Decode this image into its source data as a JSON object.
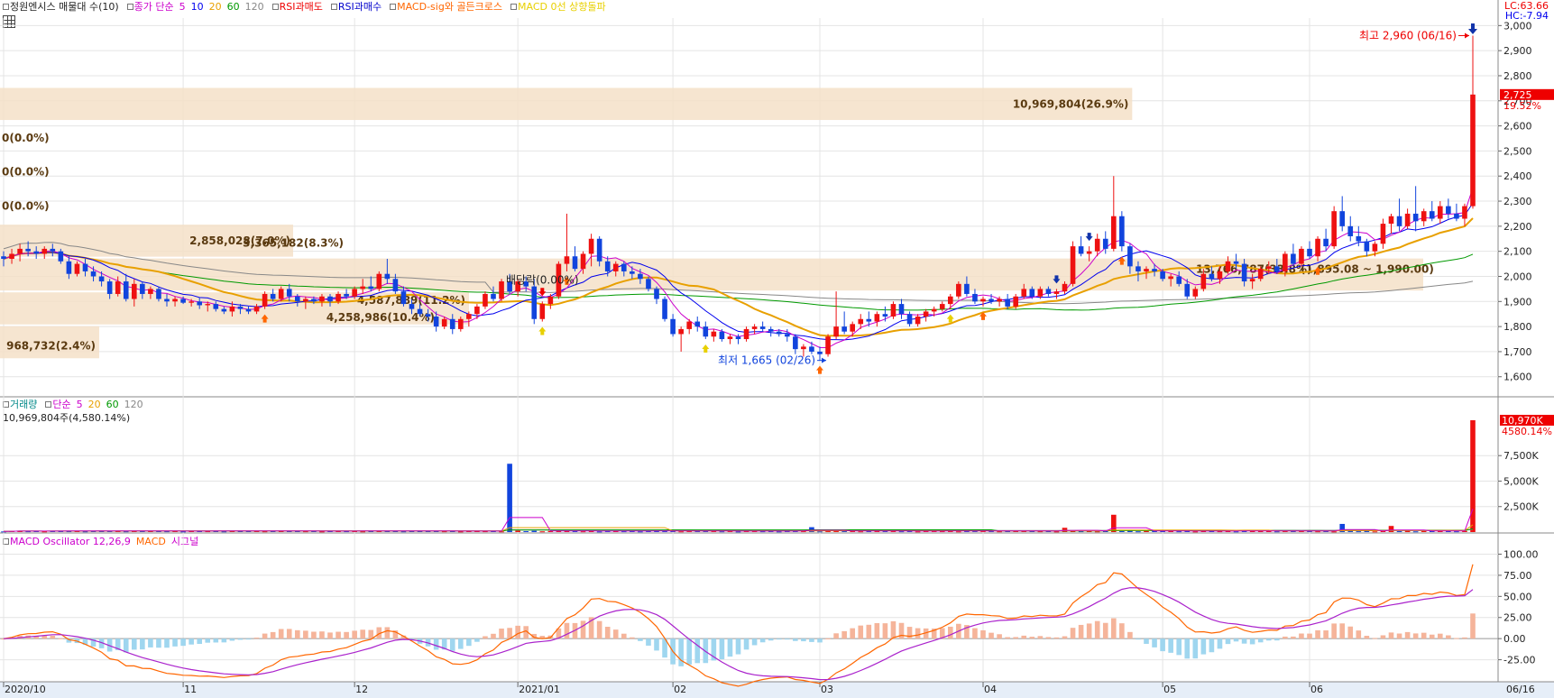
{
  "legend_price": [
    {
      "text": "정원엔시스 매물대 수(10)",
      "color": "#222222"
    },
    {
      "text": "종가 단순",
      "color": "#cc00cc"
    },
    {
      "text": "5",
      "color": "#cc00cc"
    },
    {
      "text": "10",
      "color": "#0000ee"
    },
    {
      "text": "20",
      "color": "#e8a000"
    },
    {
      "text": "60",
      "color": "#009900"
    },
    {
      "text": "120",
      "color": "#888888"
    },
    {
      "text": "RSI과매도",
      "color": "#ee0000"
    },
    {
      "text": "RSI과매수",
      "color": "#0000cc"
    },
    {
      "text": "MACD-sig와 골든크로스",
      "color": "#ff6600"
    },
    {
      "text": "MACD 0선 상향돌파",
      "color": "#e8d000"
    }
  ],
  "legend_volume": [
    {
      "text": "거래량",
      "color": "#008888"
    },
    {
      "text": "단순",
      "color": "#cc00cc"
    },
    {
      "text": "5",
      "color": "#cc00cc"
    },
    {
      "text": "20",
      "color": "#e8a000"
    },
    {
      "text": "60",
      "color": "#009900"
    },
    {
      "text": "120",
      "color": "#888888"
    }
  ],
  "legend_macd": [
    {
      "text": "MACD Oscillator 12,26,9",
      "color": "#cc00cc"
    },
    {
      "text": "MACD",
      "color": "#ff6600"
    },
    {
      "text": "시그널",
      "color": "#cc00cc"
    }
  ],
  "corner": {
    "lc": "LC:63.66",
    "hc": "HC:-7.94"
  },
  "volume_info": "10,969,804주(4,580.14%)",
  "chart_data": {
    "type": "candlestick",
    "title": "정원엔시스",
    "price_axis": {
      "ticks": [
        1600,
        1700,
        1800,
        1900,
        2000,
        2100,
        2200,
        2300,
        2400,
        2500,
        2600,
        2700,
        2800,
        2900,
        3000
      ],
      "ylim": [
        1520,
        3030
      ]
    },
    "x_labels": [
      "2020/10",
      "11",
      "12",
      "2021/01",
      "02",
      "03",
      "04",
      "05",
      "06",
      "06/16"
    ],
    "month_starts": [
      0,
      22,
      43,
      63,
      82,
      100,
      120,
      142,
      160
    ],
    "last_price": {
      "value": 2725,
      "label": "2,725",
      "change": "19.52%",
      "color": "#ee0000"
    },
    "high_annotation": {
      "label": "최고 2,960 (06/16)",
      "value": 2960
    },
    "low_annotation": {
      "label": "최저 1,665 (02/26)",
      "value": 1665
    },
    "dividend_annotation": "배당락(0.00%)",
    "ohlc": [
      [
        2080,
        2100,
        2040,
        2070
      ],
      [
        2070,
        2110,
        2050,
        2090
      ],
      [
        2090,
        2130,
        2060,
        2110
      ],
      [
        2110,
        2140,
        2080,
        2100
      ],
      [
        2100,
        2120,
        2070,
        2090
      ],
      [
        2090,
        2120,
        2070,
        2110
      ],
      [
        2110,
        2130,
        2080,
        2100
      ],
      [
        2100,
        2110,
        2050,
        2060
      ],
      [
        2060,
        2080,
        1990,
        2010
      ],
      [
        2010,
        2060,
        2000,
        2050
      ],
      [
        2050,
        2070,
        2000,
        2020
      ],
      [
        2020,
        2040,
        1980,
        2000
      ],
      [
        2000,
        2020,
        1960,
        1980
      ],
      [
        1980,
        1990,
        1910,
        1930
      ],
      [
        1930,
        2000,
        1920,
        1980
      ],
      [
        1980,
        2010,
        1900,
        1910
      ],
      [
        1910,
        1990,
        1880,
        1970
      ],
      [
        1970,
        1980,
        1910,
        1930
      ],
      [
        1930,
        1960,
        1910,
        1950
      ],
      [
        1950,
        1960,
        1900,
        1910
      ],
      [
        1910,
        1930,
        1880,
        1900
      ],
      [
        1900,
        1920,
        1880,
        1910
      ],
      [
        1910,
        1920,
        1890,
        1895
      ],
      [
        1895,
        1910,
        1880,
        1900
      ],
      [
        1900,
        1915,
        1870,
        1885
      ],
      [
        1885,
        1900,
        1860,
        1890
      ],
      [
        1890,
        1900,
        1860,
        1870
      ],
      [
        1870,
        1880,
        1850,
        1860
      ],
      [
        1860,
        1900,
        1840,
        1880
      ],
      [
        1880,
        1890,
        1850,
        1870
      ],
      [
        1870,
        1880,
        1850,
        1860
      ],
      [
        1860,
        1890,
        1850,
        1880
      ],
      [
        1880,
        1940,
        1870,
        1930
      ],
      [
        1930,
        1950,
        1900,
        1910
      ],
      [
        1910,
        1960,
        1900,
        1950
      ],
      [
        1950,
        1970,
        1900,
        1920
      ],
      [
        1920,
        1930,
        1880,
        1900
      ],
      [
        1900,
        1920,
        1870,
        1910
      ],
      [
        1910,
        1920,
        1890,
        1900
      ],
      [
        1900,
        1930,
        1880,
        1920
      ],
      [
        1920,
        1930,
        1880,
        1900
      ],
      [
        1900,
        1940,
        1890,
        1930
      ],
      [
        1930,
        1950,
        1910,
        1920
      ],
      [
        1920,
        1960,
        1910,
        1950
      ],
      [
        1950,
        1990,
        1930,
        1960
      ],
      [
        1960,
        2000,
        1940,
        1950
      ],
      [
        1950,
        2020,
        1940,
        2010
      ],
      [
        2010,
        2070,
        1970,
        1990
      ],
      [
        1990,
        2010,
        1930,
        1940
      ],
      [
        1940,
        1960,
        1880,
        1890
      ],
      [
        1890,
        1910,
        1850,
        1870
      ],
      [
        1870,
        1890,
        1840,
        1850
      ],
      [
        1850,
        1870,
        1820,
        1840
      ],
      [
        1840,
        1860,
        1780,
        1800
      ],
      [
        1800,
        1840,
        1790,
        1830
      ],
      [
        1830,
        1850,
        1770,
        1790
      ],
      [
        1790,
        1840,
        1780,
        1830
      ],
      [
        1830,
        1860,
        1800,
        1850
      ],
      [
        1850,
        1890,
        1830,
        1880
      ],
      [
        1880,
        1940,
        1870,
        1930
      ],
      [
        1930,
        1960,
        1900,
        1910
      ],
      [
        1910,
        1990,
        1900,
        1980
      ],
      [
        1980,
        2010,
        1930,
        1940
      ],
      [
        1940,
        1990,
        1920,
        1980
      ],
      [
        1980,
        2000,
        1940,
        1960
      ],
      [
        1960,
        1990,
        1810,
        1830
      ],
      [
        1830,
        1900,
        1820,
        1890
      ],
      [
        1890,
        1930,
        1870,
        1920
      ],
      [
        1920,
        2060,
        1910,
        2050
      ],
      [
        2050,
        2250,
        2020,
        2080
      ],
      [
        2080,
        2120,
        2020,
        2030
      ],
      [
        2030,
        2100,
        2010,
        2090
      ],
      [
        2090,
        2170,
        2040,
        2150
      ],
      [
        2150,
        2160,
        2040,
        2060
      ],
      [
        2060,
        2080,
        2000,
        2020
      ],
      [
        2020,
        2060,
        2000,
        2050
      ],
      [
        2050,
        2060,
        2000,
        2020
      ],
      [
        2020,
        2040,
        1990,
        2010
      ],
      [
        2010,
        2030,
        1970,
        1990
      ],
      [
        1990,
        2000,
        1940,
        1950
      ],
      [
        1950,
        1960,
        1890,
        1910
      ],
      [
        1910,
        1920,
        1820,
        1830
      ],
      [
        1830,
        1850,
        1760,
        1770
      ],
      [
        1770,
        1800,
        1700,
        1790
      ],
      [
        1790,
        1830,
        1770,
        1820
      ],
      [
        1820,
        1840,
        1780,
        1800
      ],
      [
        1800,
        1820,
        1750,
        1760
      ],
      [
        1760,
        1790,
        1740,
        1780
      ],
      [
        1780,
        1790,
        1740,
        1750
      ],
      [
        1750,
        1770,
        1730,
        1760
      ],
      [
        1760,
        1770,
        1730,
        1750
      ],
      [
        1750,
        1800,
        1740,
        1790
      ],
      [
        1790,
        1810,
        1770,
        1800
      ],
      [
        1800,
        1820,
        1780,
        1790
      ],
      [
        1790,
        1800,
        1760,
        1780
      ],
      [
        1780,
        1790,
        1760,
        1770
      ],
      [
        1770,
        1790,
        1740,
        1760
      ],
      [
        1760,
        1770,
        1690,
        1710
      ],
      [
        1710,
        1730,
        1680,
        1720
      ],
      [
        1720,
        1740,
        1690,
        1700
      ],
      [
        1700,
        1720,
        1665,
        1690
      ],
      [
        1690,
        1770,
        1680,
        1760
      ],
      [
        1760,
        1940,
        1750,
        1800
      ],
      [
        1800,
        1860,
        1770,
        1780
      ],
      [
        1780,
        1820,
        1760,
        1810
      ],
      [
        1810,
        1850,
        1790,
        1830
      ],
      [
        1830,
        1860,
        1800,
        1820
      ],
      [
        1820,
        1860,
        1800,
        1850
      ],
      [
        1850,
        1880,
        1820,
        1840
      ],
      [
        1840,
        1900,
        1830,
        1890
      ],
      [
        1890,
        1910,
        1830,
        1850
      ],
      [
        1850,
        1860,
        1800,
        1810
      ],
      [
        1810,
        1850,
        1800,
        1840
      ],
      [
        1840,
        1870,
        1820,
        1860
      ],
      [
        1860,
        1880,
        1840,
        1870
      ],
      [
        1870,
        1900,
        1860,
        1890
      ],
      [
        1890,
        1930,
        1870,
        1920
      ],
      [
        1920,
        1980,
        1910,
        1970
      ],
      [
        1970,
        2000,
        1920,
        1930
      ],
      [
        1930,
        1950,
        1890,
        1900
      ],
      [
        1900,
        1920,
        1880,
        1910
      ],
      [
        1910,
        1930,
        1890,
        1900
      ],
      [
        1900,
        1920,
        1880,
        1910
      ],
      [
        1910,
        1930,
        1870,
        1880
      ],
      [
        1880,
        1930,
        1870,
        1920
      ],
      [
        1920,
        1970,
        1910,
        1950
      ],
      [
        1950,
        1960,
        1910,
        1920
      ],
      [
        1920,
        1960,
        1910,
        1950
      ],
      [
        1950,
        1960,
        1920,
        1930
      ],
      [
        1930,
        1950,
        1910,
        1940
      ],
      [
        1940,
        1980,
        1930,
        1970
      ],
      [
        1970,
        2140,
        1960,
        2120
      ],
      [
        2120,
        2160,
        2080,
        2090
      ],
      [
        2090,
        2120,
        2060,
        2100
      ],
      [
        2100,
        2170,
        2080,
        2150
      ],
      [
        2150,
        2180,
        2090,
        2110
      ],
      [
        2110,
        2400,
        2100,
        2240
      ],
      [
        2240,
        2260,
        2100,
        2120
      ],
      [
        2120,
        2130,
        2010,
        2040
      ],
      [
        2040,
        2060,
        1980,
        2020
      ],
      [
        2020,
        2040,
        1990,
        2030
      ],
      [
        2030,
        2050,
        2000,
        2020
      ],
      [
        2020,
        2030,
        1980,
        1990
      ],
      [
        1990,
        2010,
        1960,
        2000
      ],
      [
        2000,
        2020,
        1960,
        1970
      ],
      [
        1970,
        1990,
        1910,
        1920
      ],
      [
        1920,
        1960,
        1910,
        1950
      ],
      [
        1950,
        2030,
        1940,
        2010
      ],
      [
        2010,
        2040,
        1980,
        1990
      ],
      [
        1990,
        2040,
        1970,
        2020
      ],
      [
        2020,
        2080,
        2010,
        2060
      ],
      [
        2060,
        2090,
        2030,
        2050
      ],
      [
        2050,
        2070,
        1960,
        1980
      ],
      [
        1980,
        2010,
        1950,
        1990
      ],
      [
        1990,
        2040,
        1980,
        2030
      ],
      [
        2030,
        2060,
        2010,
        2040
      ],
      [
        2040,
        2070,
        2010,
        2020
      ],
      [
        2020,
        2100,
        2000,
        2090
      ],
      [
        2090,
        2130,
        2040,
        2050
      ],
      [
        2050,
        2120,
        2040,
        2110
      ],
      [
        2110,
        2140,
        2070,
        2080
      ],
      [
        2080,
        2160,
        2060,
        2150
      ],
      [
        2150,
        2190,
        2100,
        2120
      ],
      [
        2120,
        2280,
        2110,
        2260
      ],
      [
        2260,
        2320,
        2180,
        2200
      ],
      [
        2200,
        2240,
        2140,
        2160
      ],
      [
        2160,
        2200,
        2120,
        2140
      ],
      [
        2140,
        2150,
        2080,
        2100
      ],
      [
        2100,
        2140,
        2080,
        2130
      ],
      [
        2130,
        2230,
        2110,
        2210
      ],
      [
        2210,
        2250,
        2170,
        2240
      ],
      [
        2240,
        2310,
        2180,
        2200
      ],
      [
        2200,
        2270,
        2190,
        2250
      ],
      [
        2250,
        2360,
        2180,
        2220
      ],
      [
        2220,
        2270,
        2200,
        2260
      ],
      [
        2260,
        2300,
        2220,
        2230
      ],
      [
        2230,
        2300,
        2210,
        2280
      ],
      [
        2280,
        2310,
        2230,
        2250
      ],
      [
        2250,
        2290,
        2220,
        2230
      ],
      [
        2230,
        2290,
        2200,
        2280
      ],
      [
        2280,
        2960,
        2270,
        2725
      ]
    ],
    "volume": {
      "axis_ticks": [
        {
          "v": 2500,
          "label": "2,500K"
        },
        {
          "v": 5000,
          "label": "5,000K"
        },
        {
          "v": 7500,
          "label": "7,500K"
        }
      ],
      "ylim": [
        0,
        11500
      ],
      "last": {
        "label": "10,970K",
        "change": "4580.14%"
      },
      "spikes": {
        "62": 6700,
        "99": 480,
        "130": 420,
        "136": 1700,
        "164": 800,
        "170": 600,
        "180": 10970
      }
    },
    "macd": {
      "axis_ticks": [
        {
          "v": -25,
          "label": "-25.00"
        },
        {
          "v": 0,
          "label": "0.00"
        },
        {
          "v": 25,
          "label": "25.00"
        },
        {
          "v": 50,
          "label": "50.00"
        },
        {
          "v": 75,
          "label": "75.00"
        },
        {
          "v": 100,
          "label": "100.00"
        }
      ],
      "ylim": [
        -50,
        108
      ]
    },
    "volume_profile": [
      {
        "label": "10,969,804(26.9%)",
        "low": 2620,
        "high": 2755,
        "share": 26.9
      },
      {
        "label": "0(0.0%)",
        "low": 2485,
        "high": 2620,
        "share": 0
      },
      {
        "label": "0(0.0%)",
        "low": 2350,
        "high": 2485,
        "share": 0
      },
      {
        "label": "0(0.0%)",
        "low": 2210,
        "high": 2350,
        "share": 0
      },
      {
        "label": "2,858,028(7.0%)",
        "low": 2075,
        "high": 2210,
        "share": 7.0
      },
      {
        "label": "3,365,182(8.3%)",
        "low": 1940,
        "high": 2075,
        "share": 8.3
      },
      {
        "label": "13,766,787(33.8%)",
        "low": 1940,
        "high": 2075,
        "share": 33.8,
        "sub": "(1,895.08 ~ 1,990.00)"
      },
      {
        "label": "4,587,889(11.2%)",
        "low": 1805,
        "high": 1940,
        "share": 11.2
      },
      {
        "label": "4,258,986(10.4%)",
        "low": 1805,
        "high": 1940,
        "share": 10.4
      },
      {
        "label": "968,732(2.4%)",
        "low": 1670,
        "high": 1805,
        "share": 2.4
      }
    ]
  }
}
